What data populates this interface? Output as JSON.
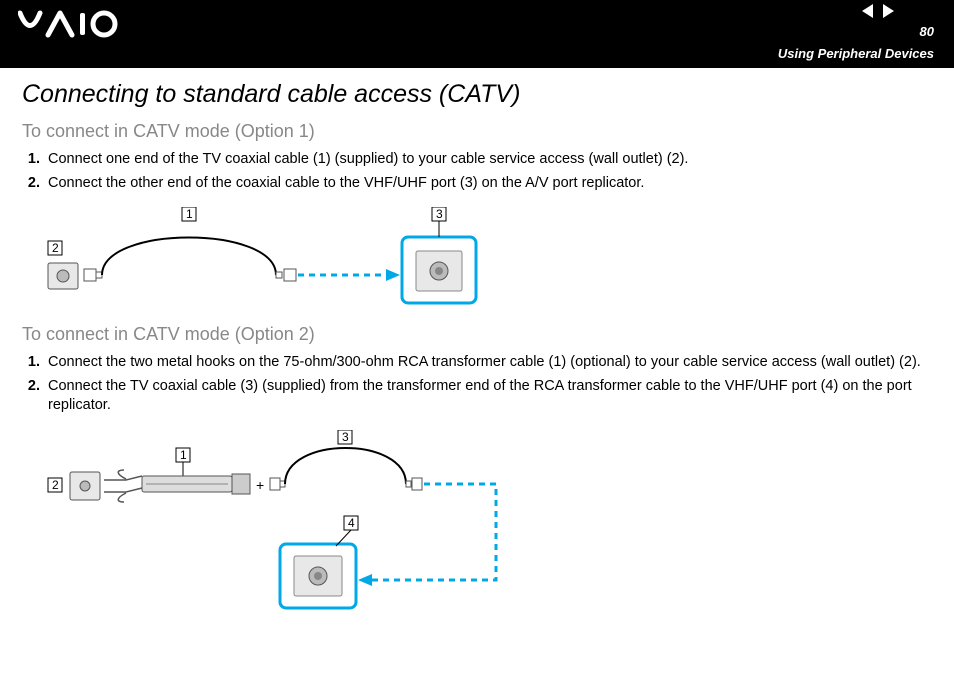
{
  "header": {
    "page_number": "80",
    "section": "Using Peripheral Devices"
  },
  "title": "Connecting to standard cable access (CATV)",
  "option1": {
    "heading": "To connect in CATV mode (Option 1)",
    "steps": [
      "Connect one end of the TV coaxial cable (1) (supplied) to your cable service access (wall outlet) (2).",
      "Connect the other end of the coaxial cable to the VHF/UHF port (3) on the A/V port replicator."
    ],
    "callouts": [
      "1",
      "2",
      "3"
    ]
  },
  "option2": {
    "heading": "To connect in CATV mode (Option 2)",
    "steps": [
      "Connect the two metal hooks on the 75-ohm/300-ohm RCA transformer cable (1) (optional) to your cable service access (wall outlet) (2).",
      "Connect the TV coaxial cable (3) (supplied) from the transformer end of the RCA transformer cable to the VHF/UHF port (4) on the port replicator."
    ],
    "callouts": [
      "1",
      "2",
      "3",
      "4"
    ]
  }
}
